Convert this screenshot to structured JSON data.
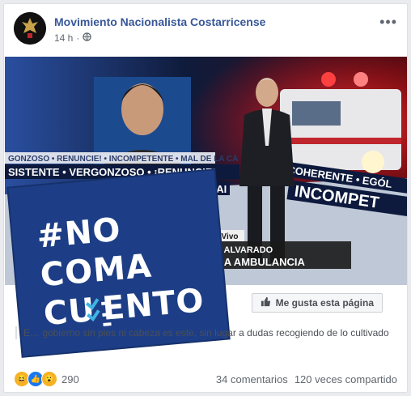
{
  "post": {
    "page_name": "Movimiento Nacionalista Costarricense",
    "time": "14 h",
    "like_page_label": "Me gusta esta página",
    "text": "E… gobierno sin pies ni cabeza es este, sin lugar a dudas recogiendo de lo cultivado",
    "reaction_count": "290",
    "comments": "34 comentarios",
    "shares": "120 veces compartido"
  },
  "image": {
    "ticker_top": "GONZOSO • RENUNCIE! • INCOMPETENTE • MAL DE LA CA",
    "ticker_mid": "SISTENTE • VERGONZOSO • ¡RENUNCIE!",
    "ticker_right_1": "COHERENTE • EGÓL",
    "ticker_right_2": "INCOMPET",
    "en_vivo": "En Vivo",
    "caption_1": "OS ALVARADO",
    "caption_2": "UNA AMBULANCIA",
    "ticker_left_2": "FAI"
  },
  "badge": {
    "line1": "#NO",
    "line2": "COMA",
    "line3": "CU ENTO"
  },
  "colors": {
    "link": "#385898",
    "badge_bg": "#1d3e86",
    "badge_check": "#3fb4e5"
  }
}
